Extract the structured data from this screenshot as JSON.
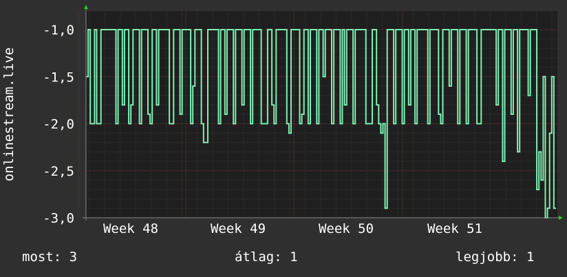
{
  "chart_data": {
    "type": "line",
    "ylabel": "onlinestream.live",
    "ylim": [
      -3.0,
      -1.0
    ],
    "yticks": [
      "-1,0",
      "-1,5",
      "-2,0",
      "-2,5",
      "-3,0"
    ],
    "xtick_labels": [
      "Week 48",
      "Week 49",
      "Week 50",
      "Week 51"
    ],
    "grid": true,
    "series": [
      {
        "color": "#7df0b4",
        "values": [
          -1.5,
          -1.0,
          -2.0,
          -2.0,
          -1.0,
          -2.0,
          -2.0,
          -1.0,
          -1.0,
          -1.0,
          -1.0,
          -1.0,
          -1.0,
          -1.0,
          -2.0,
          -1.0,
          -1.0,
          -1.8,
          -1.0,
          -1.0,
          -2.0,
          -1.8,
          -1.0,
          -1.0,
          -1.0,
          -2.0,
          -1.0,
          -1.0,
          -1.0,
          -1.9,
          -2.0,
          -1.0,
          -1.0,
          -1.8,
          -1.0,
          -1.0,
          -1.0,
          -1.0,
          -1.0,
          -2.0,
          -2.0,
          -1.0,
          -1.0,
          -1.0,
          -1.9,
          -1.0,
          -1.0,
          -1.0,
          -1.0,
          -2.0,
          -1.6,
          -1.0,
          -1.0,
          -1.0,
          -2.0,
          -2.2,
          -2.2,
          -1.0,
          -1.0,
          -1.0,
          -1.0,
          -1.0,
          -2.0,
          -1.0,
          -1.0,
          -1.9,
          -1.0,
          -1.0,
          -1.0,
          -2.0,
          -1.0,
          -1.0,
          -1.0,
          -1.8,
          -1.0,
          -1.0,
          -1.0,
          -2.0,
          -1.0,
          -1.0,
          -1.0,
          -1.0,
          -2.0,
          -2.0,
          -2.0,
          -1.0,
          -1.0,
          -1.8,
          -2.0,
          -1.0,
          -1.0,
          -1.0,
          -1.0,
          -1.0,
          -2.0,
          -2.1,
          -1.0,
          -1.0,
          -1.0,
          -1.0,
          -2.0,
          -1.9,
          -1.0,
          -1.0,
          -2.0,
          -1.0,
          -1.0,
          -1.0,
          -2.0,
          -1.0,
          -1.0,
          -1.5,
          -1.0,
          -1.0,
          -1.0,
          -2.0,
          -1.0,
          -1.0,
          -1.0,
          -2.0,
          -1.0,
          -1.8,
          -1.0,
          -1.0,
          -1.0,
          -2.0,
          -1.0,
          -1.0,
          -1.0,
          -1.0,
          -1.0,
          -2.0,
          -2.0,
          -2.0,
          -1.0,
          -1.0,
          -1.8,
          -2.0,
          -2.1,
          -2.0,
          -2.9,
          -1.0,
          -1.0,
          -1.0,
          -2.0,
          -1.0,
          -1.0,
          -1.0,
          -2.0,
          -1.0,
          -1.0,
          -1.8,
          -1.0,
          -1.0,
          -2.0,
          -1.0,
          -1.0,
          -1.0,
          -1.0,
          -1.0,
          -2.0,
          -1.0,
          -1.0,
          -1.0,
          -1.0,
          -1.9,
          -2.0,
          -1.0,
          -1.0,
          -1.0,
          -1.6,
          -1.0,
          -1.0,
          -1.0,
          -2.0,
          -1.0,
          -1.0,
          -1.0,
          -2.0,
          -1.0,
          -1.0,
          -1.0,
          -1.0,
          -2.0,
          -2.0,
          -1.0,
          -1.0,
          -1.0,
          -1.0,
          -1.0,
          -1.0,
          -1.0,
          -1.8,
          -1.0,
          -1.0,
          -2.4,
          -1.0,
          -1.0,
          -1.0,
          -1.9,
          -1.0,
          -1.0,
          -2.3,
          -1.0,
          -1.0,
          -1.0,
          -1.0,
          -1.7,
          -1.0,
          -1.0,
          -1.0,
          -2.7,
          -2.3,
          -2.6,
          -1.5,
          -3.0,
          -2.9,
          -2.1,
          -1.5,
          -2.9
        ]
      }
    ]
  },
  "stats": {
    "current": "most: 3",
    "average": "átlag: 1",
    "max": "legjobb: 1"
  },
  "colors": {
    "background": "#2f2f2f",
    "plot_background": "#1f1f1f",
    "grid_major": "#6f2f2f",
    "grid_minor": "#3b3b3b",
    "line": "#7df0b4",
    "axis_arrow": "#22cc22"
  }
}
